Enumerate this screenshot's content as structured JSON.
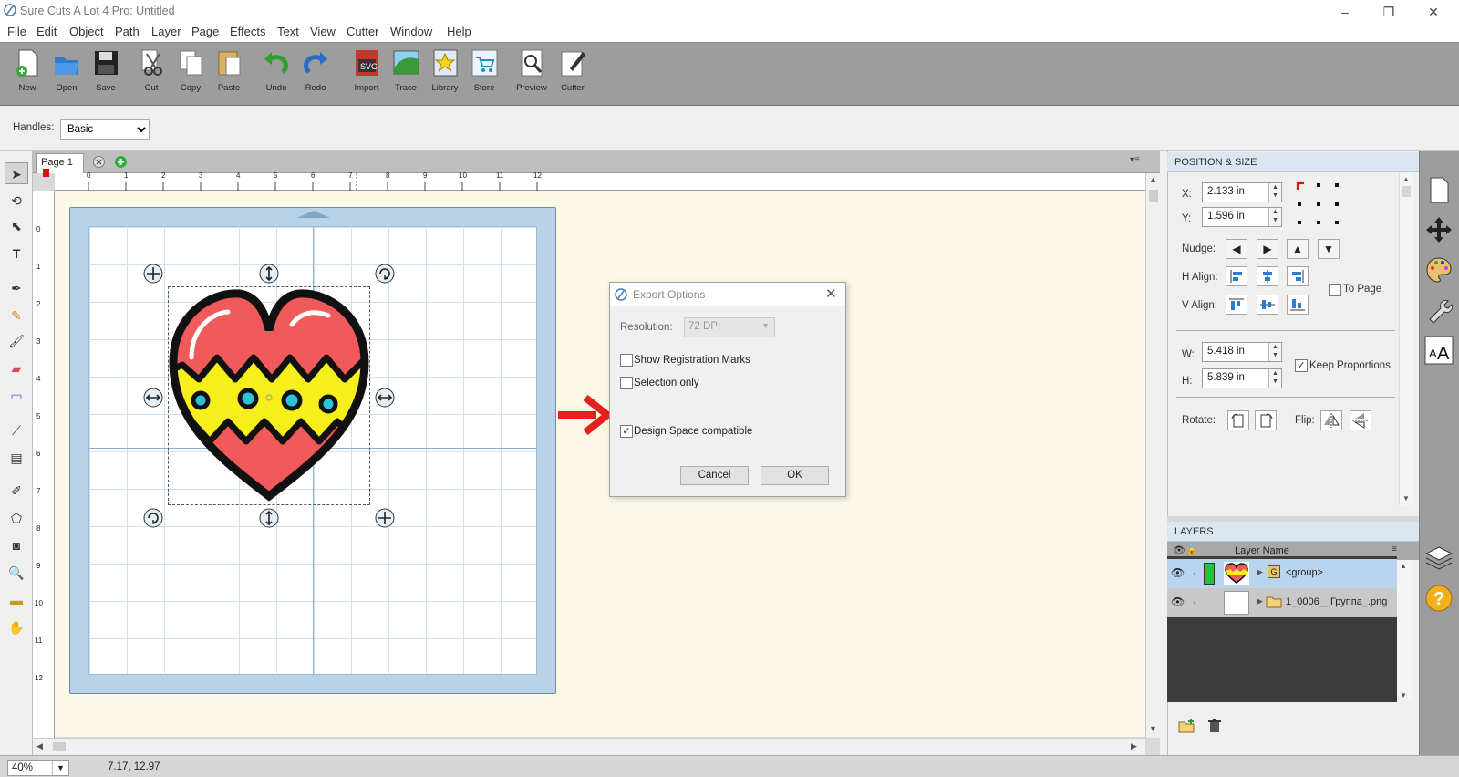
{
  "window": {
    "title": "Sure Cuts A Lot 4 Pro: Untitled"
  },
  "menu": [
    "File",
    "Edit",
    "Object",
    "Path",
    "Layer",
    "Page",
    "Effects",
    "Text",
    "View",
    "Cutter",
    "Window",
    "Help"
  ],
  "toolbar": {
    "new": "New",
    "open": "Open",
    "save": "Save",
    "cut": "Cut",
    "copy": "Copy",
    "paste": "Paste",
    "undo": "Undo",
    "redo": "Redo",
    "import": "Import",
    "trace": "Trace",
    "library": "Library",
    "store": "Store",
    "preview": "Preview",
    "cutter": "Cutter"
  },
  "props": {
    "handles_label": "Handles:",
    "handles_value": "Basic"
  },
  "tab": {
    "page": "Page 1"
  },
  "ruler": {
    "h": [
      "0",
      "1",
      "2",
      "3",
      "4",
      "5",
      "6",
      "7",
      "8",
      "9",
      "10",
      "11",
      "12"
    ],
    "v": [
      "0",
      "1",
      "2",
      "3",
      "4",
      "5",
      "6",
      "7",
      "8",
      "9",
      "10",
      "11",
      "12"
    ]
  },
  "dialog": {
    "title": "Export Options",
    "resolution_label": "Resolution:",
    "resolution_value": "72 DPI",
    "reg_marks": "Show Registration Marks",
    "selection_only": "Selection only",
    "design_space": "Design Space compatible",
    "cancel": "Cancel",
    "ok": "OK"
  },
  "pos": {
    "header": "POSITION & SIZE",
    "x_label": "X:",
    "x": "2.133 in",
    "y_label": "Y:",
    "y": "1.596 in",
    "nudge": "Nudge:",
    "halign": "H Align:",
    "valign": "V Align:",
    "to_page": "To Page",
    "w_label": "W:",
    "w": "5.418 in",
    "h_label": "H:",
    "h": "5.839 in",
    "keep": "Keep Proportions",
    "rotate": "Rotate:",
    "flip": "Flip:"
  },
  "layers": {
    "header": "LAYERS",
    "col": "Layer Name",
    "rows": [
      {
        "name": "<group>",
        "badge": "G"
      },
      {
        "name": "1_0006__Группа_.png"
      }
    ]
  },
  "status": {
    "zoom": "40%",
    "coords": "7.17, 12.97"
  }
}
